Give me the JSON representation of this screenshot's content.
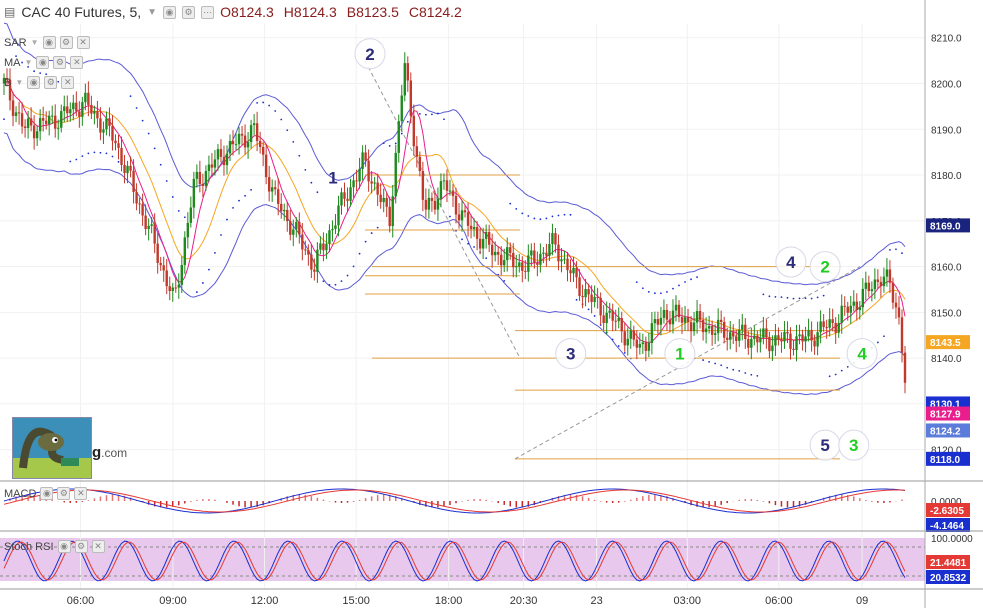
{
  "header": {
    "symbol": "CAC 40 Futures, 5,",
    "open": "O8124.3",
    "high": "H8124.3",
    "low": "B8123.5",
    "close": "C8124.2"
  },
  "indicators": {
    "sar": "SAR",
    "ma": "MA",
    "bb": "B"
  },
  "logo_text": {
    "main": "g",
    "suffix": ".com"
  },
  "chart_data": {
    "type": "candlestick",
    "price_axis": {
      "range": [
        8116,
        8213
      ],
      "ticks": [
        "8210.0",
        "8200.0",
        "8190.0",
        "8180.0",
        "8170.0",
        "8160.0",
        "8150.0",
        "8140.0",
        "8130.0",
        "8120.0"
      ],
      "tick_values": [
        8210,
        8200,
        8190,
        8180,
        8170,
        8160,
        8150,
        8140,
        8130,
        8120
      ]
    },
    "time_axis": {
      "labels": [
        "06:00",
        "09:00",
        "12:00",
        "15:00",
        "18:00",
        "20:30",
        "23",
        "03:00",
        "06:00",
        "09"
      ],
      "positions": [
        0.087,
        0.187,
        0.286,
        0.385,
        0.485,
        0.566,
        0.645,
        0.743,
        0.842,
        0.932
      ]
    },
    "price_labels": [
      {
        "text": "8169.0",
        "value": 8169.0,
        "color": "#1a237e"
      },
      {
        "text": "8143.5",
        "value": 8143.5,
        "color": "#f5a623"
      },
      {
        "text": "8130.1",
        "value": 8130.1,
        "color": "#1a2fd0"
      },
      {
        "text": "8127.9",
        "value": 8127.9,
        "color": "#e91e8c"
      },
      {
        "text": "8124.2",
        "value": 8124.2,
        "color": "#5c7cdb"
      },
      {
        "text": "8118.0",
        "value": 8118.0,
        "color": "#1a2fd0"
      }
    ],
    "wave_labels": [
      {
        "text": "1",
        "value": 8179.5,
        "t": 0.36,
        "color": "#2c2c7a",
        "circle": false
      },
      {
        "text": "2",
        "value": 8206.5,
        "t": 0.4,
        "color": "#2c2c7a",
        "circle": true
      },
      {
        "text": "3",
        "value": 8141.0,
        "t": 0.617,
        "color": "#2c2c7a",
        "circle": true
      },
      {
        "text": "4",
        "value": 8161.0,
        "t": 0.855,
        "color": "#2c2c7a",
        "circle": true
      },
      {
        "text": "5",
        "value": 8121.0,
        "t": 0.892,
        "color": "#2c2c7a",
        "circle": true
      },
      {
        "text": "1",
        "value": 8141.0,
        "t": 0.735,
        "color": "#22cc22",
        "circle": true
      },
      {
        "text": "2",
        "value": 8160.0,
        "t": 0.892,
        "color": "#22cc22",
        "circle": true
      },
      {
        "text": "3",
        "value": 8121.0,
        "t": 0.923,
        "color": "#22cc22",
        "circle": true
      },
      {
        "text": "4",
        "value": 8141.0,
        "t": 0.932,
        "color": "#22cc22",
        "circle": true
      }
    ],
    "macd": {
      "label": "MACD",
      "ticks": [
        "0.0000",
        "-2.6305",
        "-4.1464"
      ],
      "labels": [
        {
          "text": "-2.6305",
          "color": "#e53935"
        },
        {
          "text": "-4.1464",
          "color": "#1a2fd0"
        }
      ]
    },
    "stoch_rsi": {
      "label": "Stoch RSI",
      "ticks": [
        "100.0000"
      ],
      "labels": [
        {
          "text": "21.4481",
          "color": "#e53935"
        },
        {
          "text": "20.8532",
          "color": "#1a2fd0"
        }
      ]
    }
  }
}
